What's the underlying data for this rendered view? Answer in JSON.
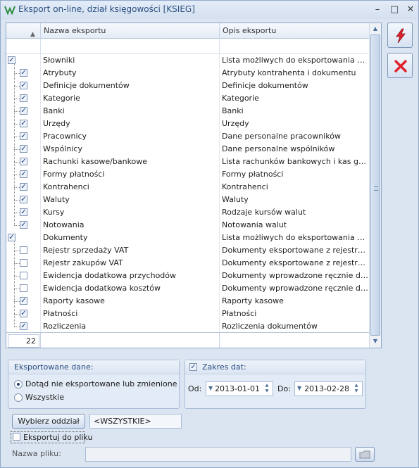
{
  "window": {
    "title": "Eksport on-line, dział księgowości [KSIEG]",
    "controls": {
      "minimize": "–",
      "maximize": "□",
      "close": "✕"
    }
  },
  "grid": {
    "columns": [
      "Nazwa eksportu",
      "Opis eksportu"
    ],
    "sort_indicator": "▲",
    "rows": [
      {
        "level": 0,
        "checked": true,
        "name": "Słowniki",
        "desc": "Lista możliwych do eksportowania słowników"
      },
      {
        "level": 1,
        "checked": true,
        "name": "Atrybuty",
        "desc": "Atrybuty kontrahenta i dokumentu"
      },
      {
        "level": 1,
        "checked": true,
        "name": "Definicje dokumentów",
        "desc": "Definicje dokumentów"
      },
      {
        "level": 1,
        "checked": true,
        "name": "Kategorie",
        "desc": "Kategorie"
      },
      {
        "level": 1,
        "checked": true,
        "name": "Banki",
        "desc": "Banki"
      },
      {
        "level": 1,
        "checked": true,
        "name": "Urzędy",
        "desc": "Urzędy"
      },
      {
        "level": 1,
        "checked": true,
        "name": "Pracownicy",
        "desc": "Dane personalne pracowników"
      },
      {
        "level": 1,
        "checked": true,
        "name": "Wspólnicy",
        "desc": "Dane personalne wspólników"
      },
      {
        "level": 1,
        "checked": true,
        "name": "Rachunki kasowe/bankowe",
        "desc": "Lista rachunków bankowych i kas gotówkowych"
      },
      {
        "level": 1,
        "checked": true,
        "name": "Formy płatności",
        "desc": "Formy płatności"
      },
      {
        "level": 1,
        "checked": true,
        "name": "Kontrahenci",
        "desc": "Kontrahenci"
      },
      {
        "level": 1,
        "checked": true,
        "name": "Waluty",
        "desc": "Waluty"
      },
      {
        "level": 1,
        "checked": true,
        "name": "Kursy",
        "desc": "Rodzaje kursów walut"
      },
      {
        "level": 1,
        "checked": true,
        "name": "Notowania",
        "desc": "Notowania walut"
      },
      {
        "level": 0,
        "checked": true,
        "name": "Dokumenty",
        "desc": "Lista możliwych do eksportowania dokumentów"
      },
      {
        "level": 1,
        "checked": false,
        "name": "Rejestr sprzedaży VAT",
        "desc": "Dokumenty eksportowane z rejestru VAT"
      },
      {
        "level": 1,
        "checked": false,
        "name": "Rejestr zakupów VAT",
        "desc": "Dokumenty eksportowane z rejestru VAT"
      },
      {
        "level": 1,
        "checked": false,
        "name": "Ewidencja dodatkowa przychodów",
        "desc": "Dokumenty wprowadzone ręcznie do ewidencji"
      },
      {
        "level": 1,
        "checked": false,
        "name": "Ewidencja dodatkowa kosztów",
        "desc": "Dokumenty wprowadzone ręcznie do ewidencji"
      },
      {
        "level": 1,
        "checked": true,
        "name": "Raporty kasowe",
        "desc": "Raporty kasowe"
      },
      {
        "level": 1,
        "checked": true,
        "name": "Płatności",
        "desc": "Płatności"
      },
      {
        "level": 1,
        "checked": true,
        "name": "Rozliczenia",
        "desc": "Rozliczenia dokumentów"
      }
    ],
    "count": "22",
    "scroll": {
      "up": "▲",
      "down": "▼"
    }
  },
  "side_buttons": {
    "run_icon": "lightning-icon",
    "cancel_icon": "cancel-icon",
    "colors": {
      "accent": "#e0202a"
    }
  },
  "exported_data": {
    "title": "Eksportowane dane:",
    "options": [
      "Dotąd nie eksportowane lub zmienione",
      "Wszystkie"
    ],
    "selected": 0
  },
  "date_range": {
    "label": "Zakres dat:",
    "checked": true,
    "from_label": "Od:",
    "from": "2013-01-01",
    "to_label": "Do:",
    "to": "2013-02-28"
  },
  "branch": {
    "button": "Wybierz oddział",
    "value": "<WSZYSTKIE>"
  },
  "export_to_file": {
    "label": "Eksportuj do pliku",
    "checked": false
  },
  "file_name": {
    "label": "Nazwa pliku:",
    "value": ""
  }
}
